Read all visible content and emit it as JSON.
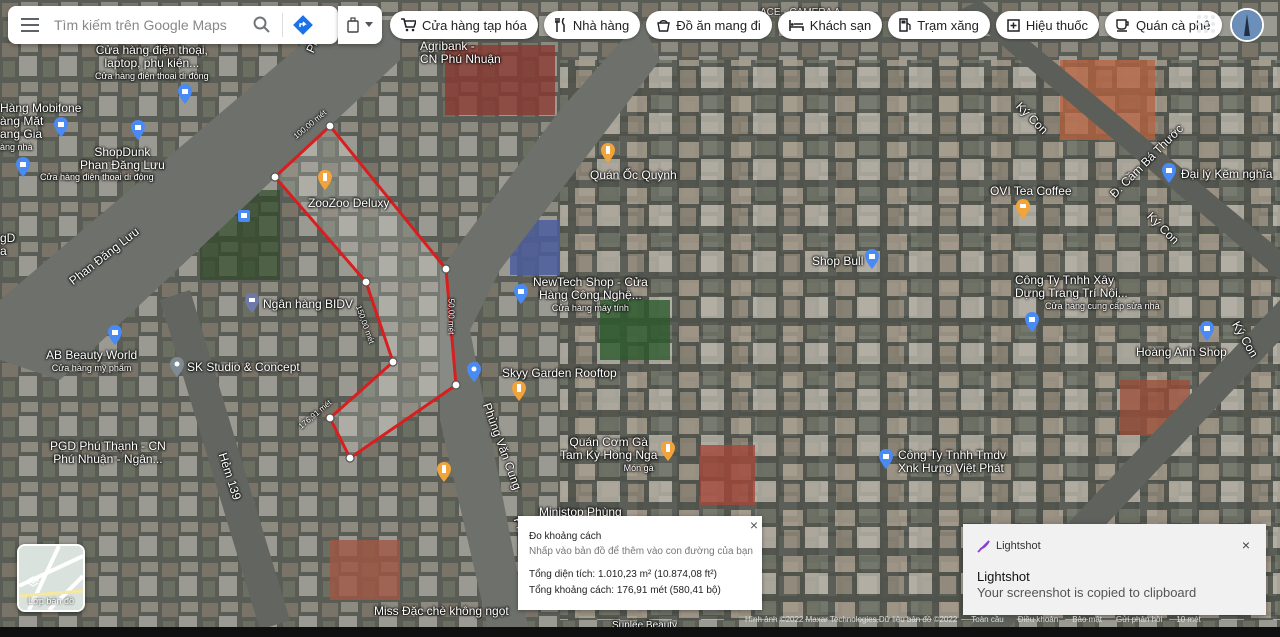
{
  "search": {
    "placeholder": "Tìm kiếm trên Google Maps"
  },
  "chips": [
    {
      "label": "Cửa hàng tạp hóa",
      "icon": "cart-icon"
    },
    {
      "label": "Nhà hàng",
      "icon": "restaurant-icon"
    },
    {
      "label": "Đồ ăn mang đi",
      "icon": "takeout-icon"
    },
    {
      "label": "Khách sạn",
      "icon": "hotel-icon"
    },
    {
      "label": "Trạm xăng",
      "icon": "gas-station-icon"
    },
    {
      "label": "Hiệu thuốc",
      "icon": "pharmacy-icon"
    },
    {
      "label": "Quán cà phê",
      "icon": "coffee-icon"
    }
  ],
  "roads": {
    "phan_dang_luu": "Phan Đăng Lưu",
    "phung_van_cung": "Phùng Văn Cung",
    "ky_con_1": "Ký Con",
    "ky_con_2": "Ký Con",
    "ky_con_3": "Ký Con",
    "cam_ba_thuoc": "Đ. Cầm Bá Thước",
    "hem_139": "Hẻm 139",
    "phu_top": "Phùng",
    "phung_bottom": "Phùng"
  },
  "places": {
    "agribank": [
      "Agribank -",
      "CN Phú Nhuận"
    ],
    "phone_store": [
      "Cửa hàng điện thoại,",
      "laptop, phụ kiện..."
    ],
    "phone_store_sub": "Cửa hàng điện thoại di động",
    "mobifone": [
      "Hàng Mobifone",
      "àng Mặt",
      "ang Gia"
    ],
    "mobifone_sub": "àng nhà",
    "shopdunk": [
      "ShopDunk",
      "Phan Đăng Lưu"
    ],
    "shopdunk_sub": "Cửa hàng điện thoại di động",
    "zoozoo": "ZooZoo Deluxy",
    "oc_quynh": "Quán Ốc Quỳnh",
    "ovi": "OVI Tea Coffee",
    "dai_ly": "Đại lý Kẽm nghĩa",
    "shop_bull": "Shop Bull",
    "newtech": [
      "NewTech Shop - Cửa",
      "Hàng Công Nghệ..."
    ],
    "newtech_sub": "Cửa hàng máy tính",
    "bidv": "Ngân hàng BIDV",
    "ab_beauty": "AB Beauty World",
    "ab_beauty_sub": "Cửa hàng mỹ phẩm",
    "sk_studio": "SK Studio & Concept",
    "skyy": "Skyy Garden Rooftop",
    "com_ga": [
      "Quán Cơm Gà",
      "Tam Kỳ Hồng Nga"
    ],
    "com_ga_sub": "Món gà",
    "pgd": [
      "PGD Phú Thạnh - CN",
      "Phú Nhuận - Ngân..."
    ],
    "cong_ty_xay": [
      "Công Ty Tnhh Xây",
      "Dựng Trang Trí Nội..."
    ],
    "cong_ty_xay_sub": "Cửa hàng cung cấp sửa nhà",
    "hoang_anh": "Hoàng Anh Shop",
    "hung_viet": [
      "Công Ty Tnhh Tmdv",
      "Xnk Hưng Việt Phát"
    ],
    "ministop": "Ministop Phùng",
    "miss_dac": "Miss Đặc chè không ngọt",
    "sunlee": "Sunlee Beauty",
    "ace": "ACE - CAMERA A...",
    "left_edge": [
      "gD",
      "a"
    ]
  },
  "measure_labels": {
    "seg1": "100,00 mét",
    "seg2": "50,00 mét",
    "seg3": "150,00 mét",
    "seg4": "176,91 mét"
  },
  "measure": {
    "title": "Đo khoảng cách",
    "hint": "Nhấp vào bản đồ để thêm vào con đường của bạn",
    "area_label": "Tổng diện tích:",
    "area_value": "1.010,23 m² (10.874,08 ft²)",
    "distance_label": "Tổng khoảng cách:",
    "distance_value": "176,91 mét (580,41 bộ)",
    "close": "×"
  },
  "layers": {
    "label": "Lớp bản đồ"
  },
  "toast": {
    "brand": "Lightshot",
    "title": "Lightshot",
    "message": "Your screenshot is copied to clipboard",
    "close": "×"
  },
  "attribution": {
    "imagery": "Hình ảnh ©2022 Maxar Technologies,Dữ liệu bản đồ ©2022",
    "all": "Toàn cầu",
    "terms": "Điều khoản",
    "privacy": "Bảo mật",
    "feedback": "Gửi phản hồi",
    "scale": "10 mét"
  },
  "colors": {
    "measure_line": "#d81e1e",
    "road": "#6b6e6a",
    "pin_blue": "#4a8af4",
    "pin_orange": "#f2a33a"
  }
}
